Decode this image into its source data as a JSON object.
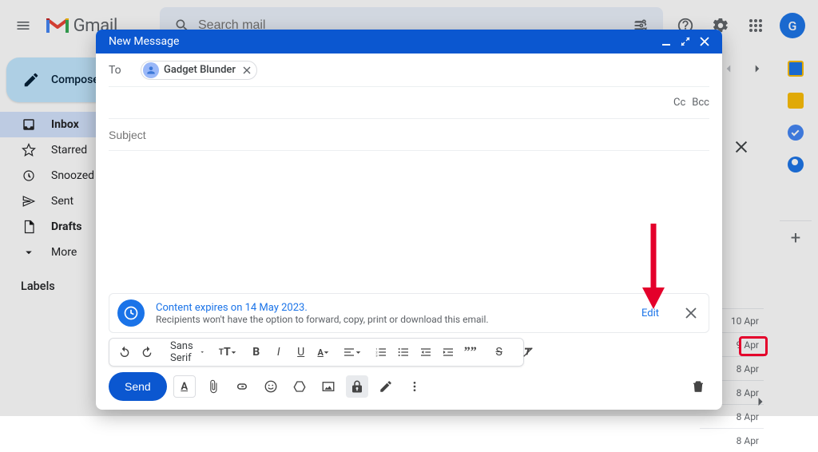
{
  "header": {
    "logo_text": "Gmail",
    "search_placeholder": "Search mail",
    "avatar_initial": "G"
  },
  "sidebar": {
    "compose_label": "Compose",
    "items": [
      {
        "label": "Inbox"
      },
      {
        "label": "Starred"
      },
      {
        "label": "Snoozed"
      },
      {
        "label": "Sent"
      },
      {
        "label": "Drafts"
      },
      {
        "label": "More"
      }
    ],
    "labels_header": "Labels"
  },
  "dates": [
    "10 Apr",
    "9 Apr",
    "8 Apr",
    "8 Apr",
    "8 Apr",
    "8 Apr"
  ],
  "compose": {
    "title": "New Message",
    "to_label": "To",
    "recipient_name": "Gadget Blunder",
    "cc_label": "Cc",
    "bcc_label": "Bcc",
    "subject_placeholder": "Subject",
    "confidential": {
      "line1": "Content expires on 14 May 2023.",
      "line2": "Recipients won't have the option to forward, copy, print or download this email.",
      "edit_label": "Edit"
    },
    "font_name": "Sans Serif",
    "send_label": "Send"
  }
}
